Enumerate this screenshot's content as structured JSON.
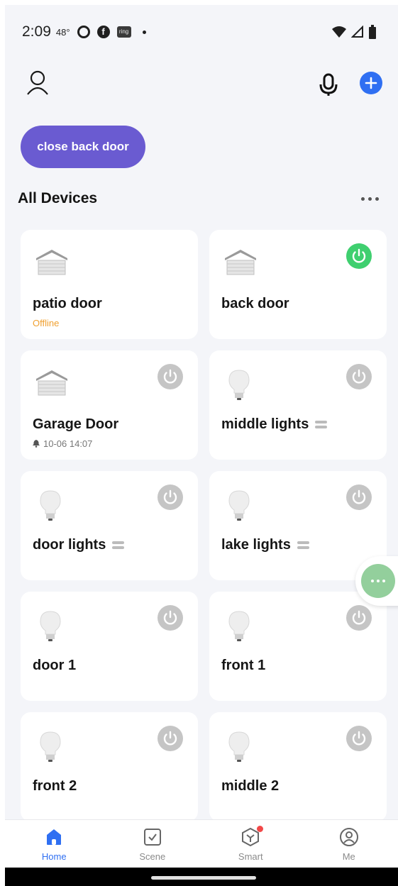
{
  "status_bar": {
    "time": "2:09",
    "temperature": "48°",
    "icons": [
      "circle-icon",
      "facebook-icon",
      "ring-icon",
      "dot-icon"
    ],
    "ring_label": "ring",
    "right_icons": [
      "wifi-icon",
      "signal-icon",
      "battery-icon"
    ]
  },
  "header": {
    "icons": [
      "user-icon",
      "microphone-icon",
      "add-icon"
    ]
  },
  "scene_button": {
    "label": "close back door",
    "color": "#6a5bd1"
  },
  "section": {
    "title": "All Devices"
  },
  "devices": [
    {
      "name": "patio door",
      "type": "garage",
      "status": "Offline",
      "power": null
    },
    {
      "name": "back door",
      "type": "garage",
      "status": "",
      "power": "on"
    },
    {
      "name": "Garage Door",
      "type": "garage",
      "status": "10-06 14:07",
      "power": "off"
    },
    {
      "name": "middle lights",
      "type": "bulb",
      "status": "",
      "power": "off",
      "group": true
    },
    {
      "name": "door lights",
      "type": "bulb",
      "status": "",
      "power": "off",
      "group": true
    },
    {
      "name": "lake lights",
      "type": "bulb",
      "status": "",
      "power": "off",
      "group": true
    },
    {
      "name": "door 1",
      "type": "bulb",
      "status": "",
      "power": "off"
    },
    {
      "name": "front 1",
      "type": "bulb",
      "status": "",
      "power": "off"
    },
    {
      "name": "front 2",
      "type": "bulb",
      "status": "",
      "power": "off"
    },
    {
      "name": "middle 2",
      "type": "bulb",
      "status": "",
      "power": "off"
    }
  ],
  "nav": [
    {
      "label": "Home",
      "icon": "home-icon",
      "active": true
    },
    {
      "label": "Scene",
      "icon": "scene-icon",
      "active": false
    },
    {
      "label": "Smart",
      "icon": "smart-icon",
      "active": false,
      "badge": true
    },
    {
      "label": "Me",
      "icon": "me-icon",
      "active": false
    }
  ],
  "colors": {
    "accent": "#2f6ff2",
    "power_on": "#3fcf6f",
    "power_off": "#c5c5c5",
    "offline": "#f0a030"
  }
}
